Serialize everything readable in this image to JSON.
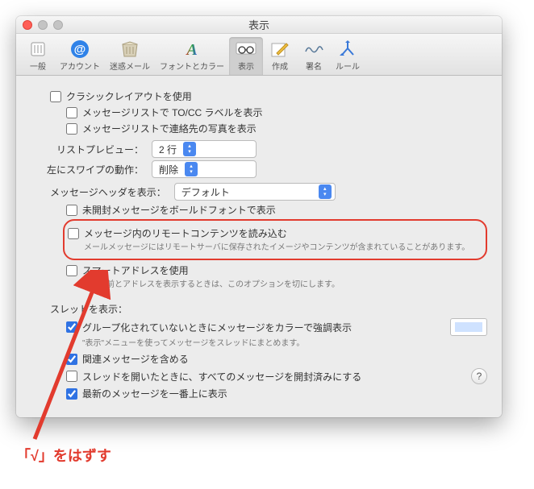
{
  "window": {
    "title": "表示"
  },
  "toolbar": {
    "items": [
      {
        "label": "一般"
      },
      {
        "label": "アカウント"
      },
      {
        "label": "迷惑メール"
      },
      {
        "label": "フォントとカラー"
      },
      {
        "label": "表示"
      },
      {
        "label": "作成"
      },
      {
        "label": "署名"
      },
      {
        "label": "ルール"
      }
    ]
  },
  "opts": {
    "classic": "クラシックレイアウトを使用",
    "tocc": "メッセージリストで TO/CC ラベルを表示",
    "photos": "メッセージリストで連絡先の写真を表示",
    "preview_label": "リストプレビュー：",
    "preview_value": "2 行",
    "swipe_label": "左にスワイプの動作：",
    "swipe_value": "削除",
    "header_label": "メッセージヘッダを表示：",
    "header_value": "デフォルト",
    "bold": "未開封メッセージをボールドフォントで表示",
    "remote": "メッセージ内のリモートコンテンツを読み込む",
    "remote_sub": "メールメッセージにはリモートサーバに保存されたイメージやコンテンツが含まれていることがあります。",
    "smart": "スマートアドレスを使用",
    "smart_sub": "常に名前とアドレスを表示するときは、このオプションを切にします。",
    "thread_header": "スレッドを表示：",
    "color_unthreaded": "グループ化されていないときにメッセージをカラーで強調表示",
    "color_sub": "\"表示\"メニューを使ってメッセージをスレッドにまとめます。",
    "include_related": "関連メッセージを含める",
    "mark_read": "スレッドを開いたときに、すべてのメッセージを開封済みにする",
    "newest_top": "最新のメッセージを一番上に表示"
  },
  "annotation": "「√」をはずす"
}
